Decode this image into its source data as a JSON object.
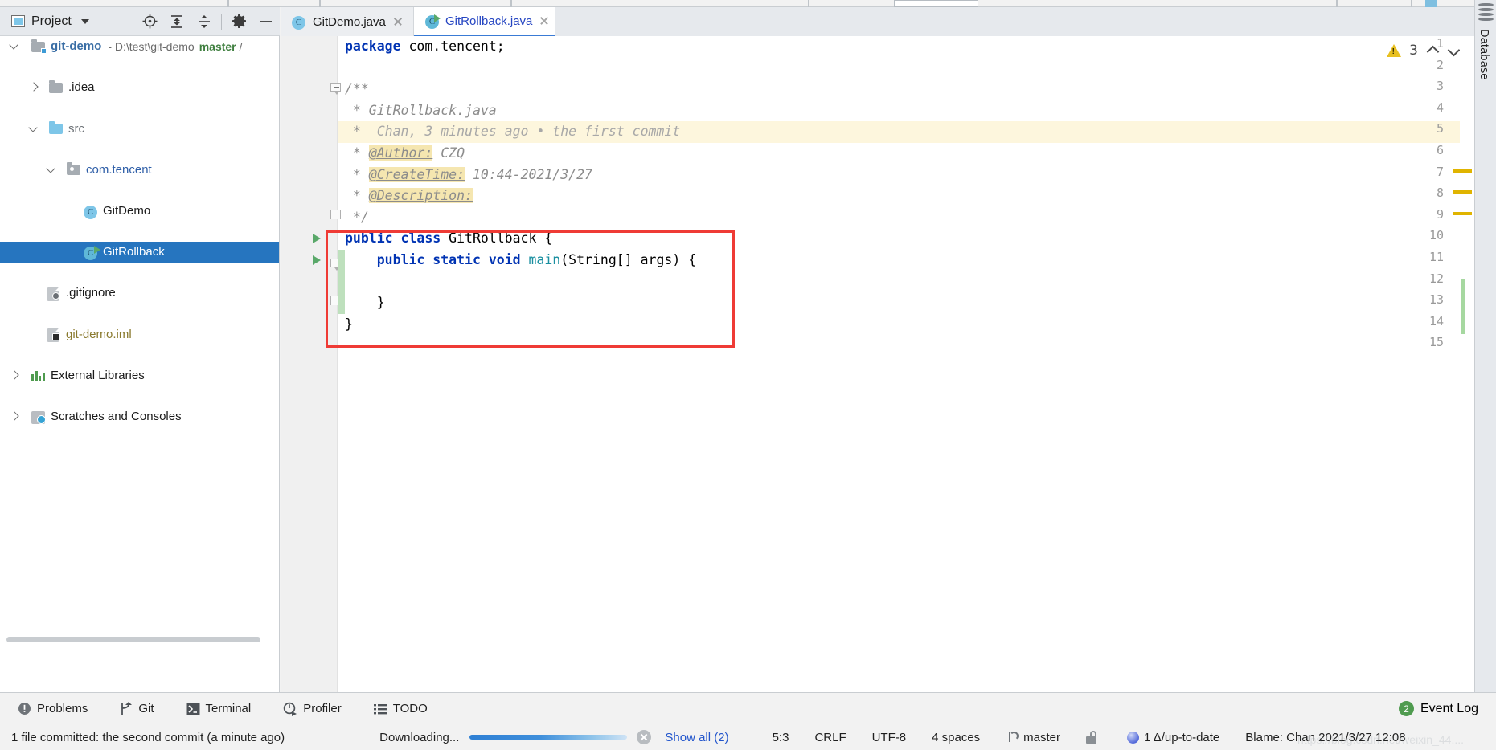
{
  "project_panel": {
    "title": "Project",
    "caret_icon": "chevron-down-icon",
    "tools": [
      "locate-icon",
      "expand-all-icon",
      "collapse-all-icon",
      "settings-gear-icon",
      "hide-minus-icon"
    ],
    "tree": [
      {
        "label": "git-demo",
        "kind": "project-root",
        "indent": 0,
        "arrow": "open",
        "path_text": "- D:\\test\\git-demo",
        "branch_text": "master",
        "slash_text": "/",
        "selected": false
      },
      {
        "label": ".idea",
        "kind": "folder",
        "indent": 1,
        "arrow": "closed",
        "selected": false
      },
      {
        "label": "src",
        "kind": "source-folder",
        "indent": 2,
        "arrow": "open",
        "selected": false
      },
      {
        "label": "com.tencent",
        "kind": "package",
        "indent": 3,
        "arrow": "open",
        "selected": false
      },
      {
        "label": "GitDemo",
        "kind": "java-class",
        "indent": 4,
        "arrow": "none",
        "selected": false
      },
      {
        "label": "GitRollback",
        "kind": "java-class-runnable",
        "indent": 4,
        "arrow": "none",
        "selected": true
      },
      {
        "label": ".gitignore",
        "kind": "gitignore-file",
        "indent": 3,
        "arrow": "none",
        "selected": false
      },
      {
        "label": "git-demo.iml",
        "kind": "iml-file",
        "indent": 3,
        "arrow": "none",
        "selected": false
      },
      {
        "label": "External Libraries",
        "kind": "libraries",
        "indent": 0,
        "arrow": "closed",
        "selected": false
      },
      {
        "label": "Scratches and Consoles",
        "kind": "scratches",
        "indent": 0,
        "arrow": "closed",
        "selected": false
      }
    ]
  },
  "tabs": [
    {
      "label": "GitDemo.java",
      "icon": "java-class-icon",
      "active": false,
      "close_icon": "close-icon"
    },
    {
      "label": "GitRollback.java",
      "icon": "java-class-runnable-icon",
      "active": true,
      "close_icon": "close-icon"
    }
  ],
  "editor": {
    "line_numbers": [
      "1",
      "2",
      "3",
      "4",
      "5",
      "6",
      "7",
      "8",
      "9",
      "10",
      "11",
      "12",
      "13",
      "14",
      "15"
    ],
    "code_lines": [
      {
        "n": 1,
        "segments": [
          {
            "t": "package ",
            "c": "kw"
          },
          {
            "t": "com.tencent;",
            "c": "plain"
          }
        ]
      },
      {
        "n": 2,
        "segments": []
      },
      {
        "n": 3,
        "segments": [
          {
            "t": "/**",
            "c": "cmt"
          }
        ]
      },
      {
        "n": 4,
        "segments": [
          {
            "t": " * GitRollback.java",
            "c": "cmt"
          }
        ]
      },
      {
        "n": 5,
        "segments": [
          {
            "t": " *  ",
            "c": "cmt"
          },
          {
            "t": "Chan, 3 minutes ago • the first commit",
            "c": "cmt-blame"
          }
        ]
      },
      {
        "n": 6,
        "segments": [
          {
            "t": " * ",
            "c": "cmt"
          },
          {
            "t": "@Author:",
            "c": "cmt-ann"
          },
          {
            "t": " CZQ",
            "c": "cmt"
          }
        ]
      },
      {
        "n": 7,
        "segments": [
          {
            "t": " * ",
            "c": "cmt"
          },
          {
            "t": "@CreateTime:",
            "c": "cmt-ann"
          },
          {
            "t": " 10:44-2021/3/27",
            "c": "cmt"
          }
        ]
      },
      {
        "n": 8,
        "segments": [
          {
            "t": " * ",
            "c": "cmt"
          },
          {
            "t": "@Description:",
            "c": "cmt-ann"
          }
        ]
      },
      {
        "n": 9,
        "segments": [
          {
            "t": " */",
            "c": "cmt"
          }
        ]
      },
      {
        "n": 10,
        "segments": [
          {
            "t": "public ",
            "c": "kw"
          },
          {
            "t": "class ",
            "c": "kw"
          },
          {
            "t": "GitRollback {",
            "c": "plain"
          }
        ]
      },
      {
        "n": 11,
        "segments": [
          {
            "t": "    ",
            "c": "plain"
          },
          {
            "t": "public ",
            "c": "kw"
          },
          {
            "t": "static ",
            "c": "kw"
          },
          {
            "t": "void ",
            "c": "kw"
          },
          {
            "t": "main",
            "c": "type"
          },
          {
            "t": "(String[] args) {",
            "c": "plain"
          }
        ]
      },
      {
        "n": 12,
        "segments": []
      },
      {
        "n": 13,
        "segments": [
          {
            "t": "    }",
            "c": "plain"
          }
        ]
      },
      {
        "n": 14,
        "segments": [
          {
            "t": "}",
            "c": "plain"
          }
        ]
      },
      {
        "n": 15,
        "segments": []
      }
    ],
    "highlighted_line": 5,
    "run_gutter_lines": [
      10,
      11
    ],
    "inspection": {
      "warning_icon": "warning-triangle-icon",
      "count": "3",
      "prev_icon": "chevron-up-icon",
      "next_icon": "chevron-down-icon"
    },
    "annotation_rect_color": "#ef3b35",
    "marker_color": "#e0b400",
    "change_bar_color": "#bee0bd"
  },
  "right_sidebar": {
    "label": "Database",
    "icon": "database-icon"
  },
  "bottom_bar": {
    "items": [
      {
        "label": "Problems",
        "icon": "problems-icon"
      },
      {
        "label": "Git",
        "icon": "git-branch-icon"
      },
      {
        "label": "Terminal",
        "icon": "terminal-icon"
      },
      {
        "label": "Profiler",
        "icon": "profiler-icon"
      },
      {
        "label": "TODO",
        "icon": "todo-list-icon"
      }
    ],
    "event_log": {
      "label": "Event Log",
      "count": "2"
    }
  },
  "status_bar": {
    "commit_message": "1 file committed: the second commit (a minute ago)",
    "progress_label": "Downloading...",
    "cancel_icon": "cancel-circle-icon",
    "show_all": "Show all (2)",
    "caret_position": "5:3",
    "line_separator": "CRLF",
    "encoding": "UTF-8",
    "indent": "4 spaces",
    "branch": "master",
    "branch_icon": "git-branch-icon",
    "lock_icon": "unlocked-icon",
    "sync_status": "1 Δ/up-to-date",
    "sync_icon": "blue-sphere-icon",
    "blame": "Blame: Chan 2021/3/27 12:08",
    "watermark": "https://blog.csdn.net/weixin_44...."
  }
}
